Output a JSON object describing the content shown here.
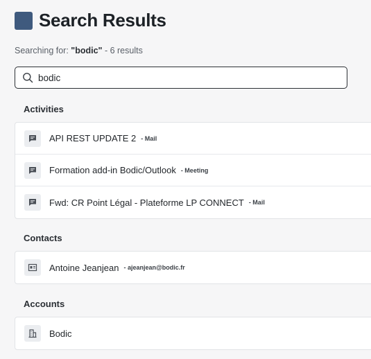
{
  "header": {
    "title": "Search Results"
  },
  "search": {
    "meta_prefix": "Searching for: ",
    "query_display": "\"bodic\"",
    "meta_suffix": " - 6 results",
    "value": "bodic"
  },
  "sections": {
    "activities": {
      "title": "Activities",
      "items": [
        {
          "label": "API REST UPDATE 2",
          "meta": "- Mail",
          "icon": "message-icon"
        },
        {
          "label": "Formation add-in Bodic/Outlook",
          "meta": "- Meeting",
          "icon": "message-icon"
        },
        {
          "label": "Fwd: CR Point Légal - Plateforme LP CONNECT",
          "meta": "- Mail",
          "icon": "message-icon"
        }
      ]
    },
    "contacts": {
      "title": "Contacts",
      "items": [
        {
          "label": "Antoine Jeanjean",
          "meta": "- ajeanjean@bodic.fr",
          "icon": "contact-card-icon"
        }
      ]
    },
    "accounts": {
      "title": "Accounts",
      "items": [
        {
          "label": "Bodic",
          "icon": "building-icon"
        }
      ]
    }
  },
  "colors": {
    "accent": "#3f5a7e",
    "icon_bg": "#ebedf0"
  }
}
